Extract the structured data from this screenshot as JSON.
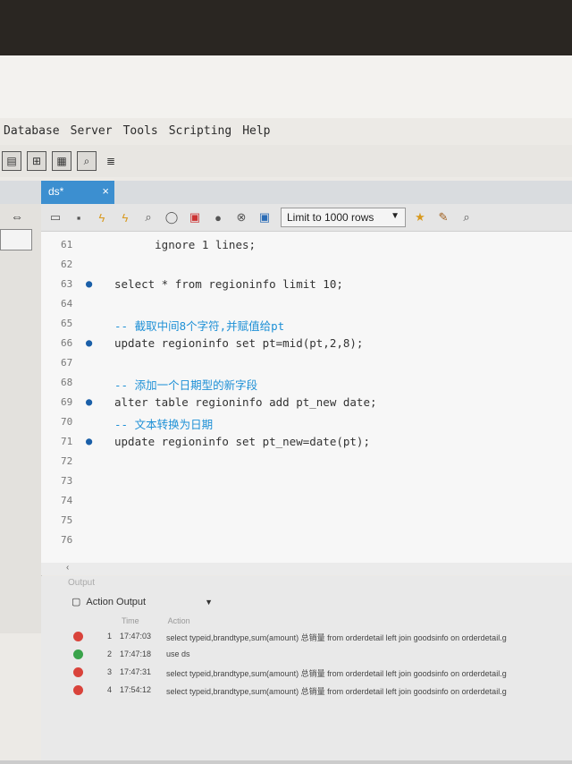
{
  "menu": [
    "Database",
    "Server",
    "Tools",
    "Scripting",
    "Help"
  ],
  "main_toolbar_icons": [
    "sql-file-icon",
    "schema-icon",
    "table-icon",
    "inspect-icon",
    "db-stack-icon"
  ],
  "tab": {
    "label": "ds*",
    "close": "×"
  },
  "editor_toolbar": {
    "icons_left": [
      "open-folder-icon",
      "save-icon",
      "execute-icon",
      "execute-current-icon",
      "explain-icon",
      "stop-icon",
      "toggle-icon",
      "commit-icon",
      "rollback-icon",
      "autocommit-icon"
    ],
    "limit_label": "Limit to 1000 rows",
    "icons_right": [
      "bookmark-icon",
      "beautify-icon",
      "find-icon"
    ]
  },
  "editor_lines": [
    {
      "num": "61",
      "dot": false,
      "code": "      ignore 1 lines;"
    },
    {
      "num": "62",
      "dot": false,
      "code": ""
    },
    {
      "num": "63",
      "dot": true,
      "code": "select * from regioninfo limit 10;"
    },
    {
      "num": "64",
      "dot": false,
      "code": ""
    },
    {
      "num": "65",
      "dot": false,
      "code": "-- 截取中间8个字符,并赋值给pt"
    },
    {
      "num": "66",
      "dot": true,
      "code": "update regioninfo set pt=mid(pt,2,8);"
    },
    {
      "num": "67",
      "dot": false,
      "code": ""
    },
    {
      "num": "68",
      "dot": false,
      "code": "-- 添加一个日期型的新字段"
    },
    {
      "num": "69",
      "dot": true,
      "code": "alter table regioninfo add pt_new date;"
    },
    {
      "num": "70",
      "dot": false,
      "code": "-- 文本转换为日期"
    },
    {
      "num": "71",
      "dot": true,
      "code": "update regioninfo set pt_new=date(pt);"
    },
    {
      "num": "72",
      "dot": false,
      "code": ""
    },
    {
      "num": "73",
      "dot": false,
      "code": ""
    },
    {
      "num": "74",
      "dot": false,
      "code": ""
    },
    {
      "num": "75",
      "dot": false,
      "code": ""
    },
    {
      "num": "76",
      "dot": false,
      "code": ""
    }
  ],
  "output": {
    "panel_label": "Output",
    "selector_label": "Action Output",
    "headers": [
      "Time",
      "Action"
    ],
    "rows": [
      {
        "status": "error",
        "num": "1",
        "time": "17:47:03",
        "action": "select typeid,brandtype,sum(amount) 总销量 from orderdetail left join goodsinfo on orderdetail.g"
      },
      {
        "status": "ok",
        "num": "2",
        "time": "17:47:18",
        "action": "use ds"
      },
      {
        "status": "error",
        "num": "3",
        "time": "17:47:31",
        "action": "select typeid,brandtype,sum(amount) 总销量 from orderdetail left join goodsinfo on orderdetail.g"
      },
      {
        "status": "error",
        "num": "4",
        "time": "17:54:12",
        "action": "select typeid,brandtype,sum(amount) 总销量 from orderdetail left join goodsinfo on orderdetail.g"
      }
    ]
  }
}
